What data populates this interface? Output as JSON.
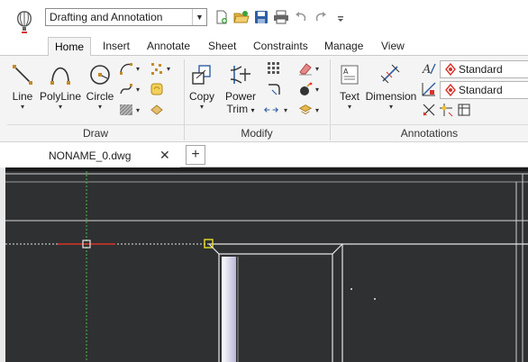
{
  "quick_access": {
    "workspace": "Drafting and Annotation",
    "buttons": [
      "new-icon",
      "open-icon",
      "save-icon",
      "print-icon",
      "undo-icon",
      "redo-icon",
      "customize-icon"
    ]
  },
  "tabs": [
    {
      "label": "Home",
      "active": true
    },
    {
      "label": "Insert"
    },
    {
      "label": "Annotate"
    },
    {
      "label": "Sheet"
    },
    {
      "label": "Constraints"
    },
    {
      "label": "Manage"
    },
    {
      "label": "View"
    }
  ],
  "ribbon": {
    "draw": {
      "title": "Draw",
      "line": "Line",
      "polyline": "PolyLine",
      "circle": "Circle"
    },
    "modify": {
      "title": "Modify",
      "copy": "Copy",
      "power_trim_1": "Power",
      "power_trim_2": "Trim"
    },
    "annotations": {
      "title": "Annotations",
      "text": "Text",
      "dimension": "Dimension",
      "text_style": "Standard",
      "dim_style": "Standard"
    }
  },
  "document": {
    "tab_name": "NONAME_0.dwg",
    "close": "✕",
    "new_tab": "+"
  },
  "colors": {
    "canvas_bg": "#2f3031",
    "accent_red": "#d9322b",
    "grip_yellow": "#e7e026"
  }
}
